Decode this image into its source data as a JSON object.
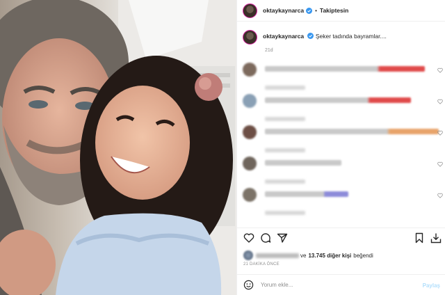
{
  "header": {
    "username": "oktaykaynarca",
    "separator": "•",
    "follow_label": "Takiptesin",
    "verified_icon": "verified-badge-icon"
  },
  "caption": {
    "username": "oktaykaynarca",
    "text": "Şeker tadında bayramlar....",
    "age": "21d"
  },
  "comments": [
    {
      "avatar_color": "#7d6a5d",
      "line_color": "#c9c9c9",
      "accent": "#e04a4a"
    },
    {
      "avatar_color": "#8aa0b5",
      "line_color": "#c9c9c9",
      "accent": "#e04a4a"
    },
    {
      "avatar_color": "#6d4f45",
      "line_color": "#c9c9c9",
      "accent": "#e8a36a"
    },
    {
      "avatar_color": "#6f655c",
      "line_color": "#c9c9c9",
      "accent": "#c9c9c9"
    },
    {
      "avatar_color": "#7c7368",
      "line_color": "#c9c9c9",
      "accent": "#8d8bd9"
    }
  ],
  "actions": {
    "like_icon": "heart-icon",
    "comment_icon": "comment-icon",
    "share_icon": "paper-plane-icon",
    "save_icon": "bookmark-icon",
    "download_icon": "download-icon"
  },
  "likes": {
    "prefix": "ve",
    "count_text": "13.745 diğer kişi",
    "suffix": "beğendi"
  },
  "posted_time": "21 DAKİKA ÖNCE",
  "comment_box": {
    "placeholder": "Yorum ekle...",
    "share_label": "Paylaş"
  },
  "colors": {
    "verified": "#3897f0",
    "share_disabled": "#b2dffc",
    "muted": "#8e8e8e"
  }
}
